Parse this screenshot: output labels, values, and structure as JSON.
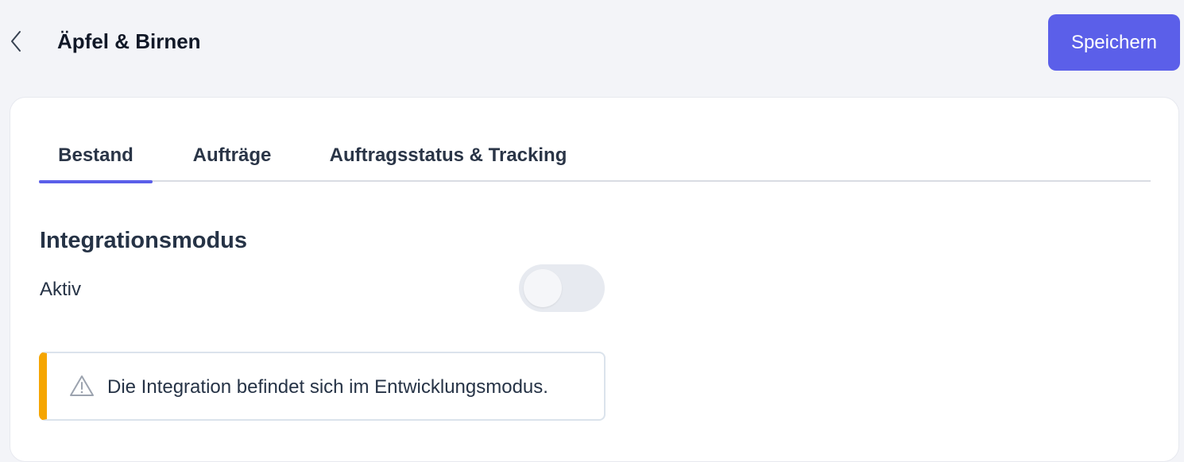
{
  "header": {
    "back_icon": "chevron-left-icon",
    "title": "Äpfel & Birnen",
    "save_label": "Speichern"
  },
  "tabs": [
    {
      "label": "Bestand",
      "active": true
    },
    {
      "label": "Aufträge",
      "active": false
    },
    {
      "label": "Auftragsstatus & Tracking",
      "active": false
    }
  ],
  "section": {
    "title": "Integrationsmodus",
    "toggle_label": "Aktiv",
    "toggle_on": false
  },
  "alert": {
    "icon": "warning-icon",
    "text": "Die Integration befindet sich im Entwicklungsmodus.",
    "accent_color": "#f5a500"
  },
  "colors": {
    "accent": "#5b5fe9",
    "background": "#f3f4f8",
    "warning": "#f5a500"
  }
}
